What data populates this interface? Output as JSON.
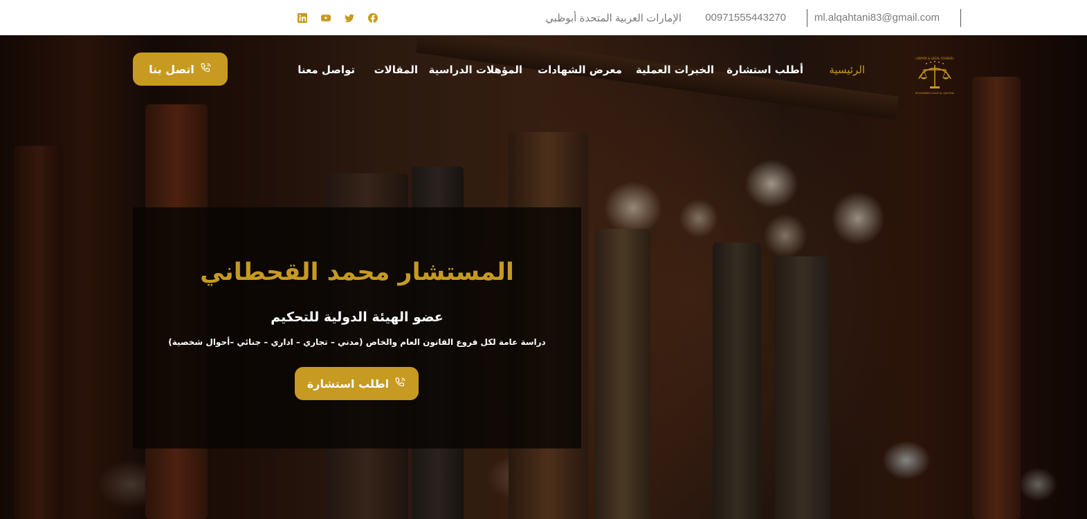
{
  "topbar": {
    "email": "ml.alqahtani83@gmail.com",
    "phone": "00971555443270",
    "location": "الإمارات العربية المتحدة أبوظبي",
    "socials": [
      "facebook-icon",
      "twitter-icon",
      "youtube-icon",
      "linkedin-icon"
    ]
  },
  "nav": {
    "items": [
      {
        "label": "الرئيسية",
        "active": true
      },
      {
        "label": "أطلب استشارة",
        "active": false
      },
      {
        "label": "الخبرات العملية",
        "active": false
      },
      {
        "label": "معرض الشهادات",
        "active": false
      },
      {
        "label": "المؤهلات الدراسية",
        "active": false
      },
      {
        "label": "المقالات",
        "active": false
      },
      {
        "label": "تواصل معنا",
        "active": false
      }
    ],
    "contact_button": "اتصل بنا"
  },
  "hero": {
    "title": "المستشار محمد القحطاني",
    "subtitle": "عضو الهيئة الدولية للتحكيم",
    "description": "دراسة عامة لكل فروع القانون العام والخاص (مدني – تجاري – اداري – جنائي –أحوال شخصية)",
    "cta_button": "اطلب استشارة"
  },
  "logo": {
    "top_text": "LAWYER & LEGAL COUNSEL",
    "bottom_text": "MOHAMMED SAAD AL QAHTANI"
  },
  "colors": {
    "accent": "#c79a21",
    "topbar_bg": "#ffffff",
    "topbar_text": "#7a7a7a"
  }
}
